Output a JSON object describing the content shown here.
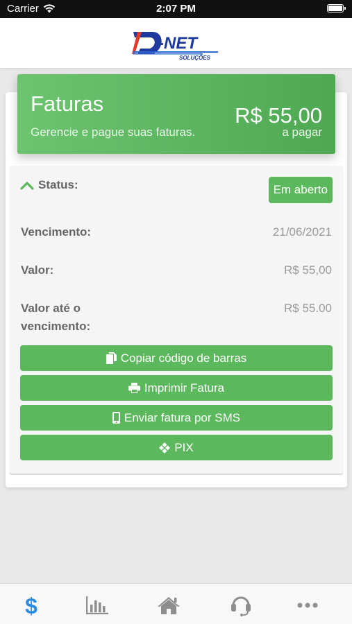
{
  "status_bar": {
    "carrier": "Carrier",
    "time": "2:07 PM"
  },
  "header": {
    "logo_text": "D-NET",
    "logo_sub": "SOLUÇÕES"
  },
  "hero": {
    "title": "Faturas",
    "subtitle": "Gerencie e pague suas faturas.",
    "amount": "R$ 55,00",
    "amount_caption": "a pagar"
  },
  "invoice": {
    "status_label": "Status:",
    "status_badge": "Em aberto",
    "rows": [
      {
        "label": "Vencimento:",
        "value": "21/06/2021"
      },
      {
        "label": "Valor:",
        "value": "R$ 55,00"
      },
      {
        "label_line1": "Valor até o",
        "label_line2": "vencimento:",
        "value": "R$ 55.00"
      }
    ]
  },
  "actions": {
    "copy_barcode": "Copiar código de barras",
    "print_invoice": "Imprimir Fatura",
    "send_sms": "Enviar fatura por SMS",
    "pix": "PIX"
  },
  "colors": {
    "brand_green": "#5cb85c",
    "active_tab": "#2a8be0",
    "inactive_tab": "#8e8e8e"
  },
  "tabs": [
    {
      "icon": "dollar-icon",
      "active": true
    },
    {
      "icon": "bar-chart-icon",
      "active": false
    },
    {
      "icon": "home-icon",
      "active": false
    },
    {
      "icon": "headset-icon",
      "active": false
    },
    {
      "icon": "more-icon",
      "active": false
    }
  ]
}
